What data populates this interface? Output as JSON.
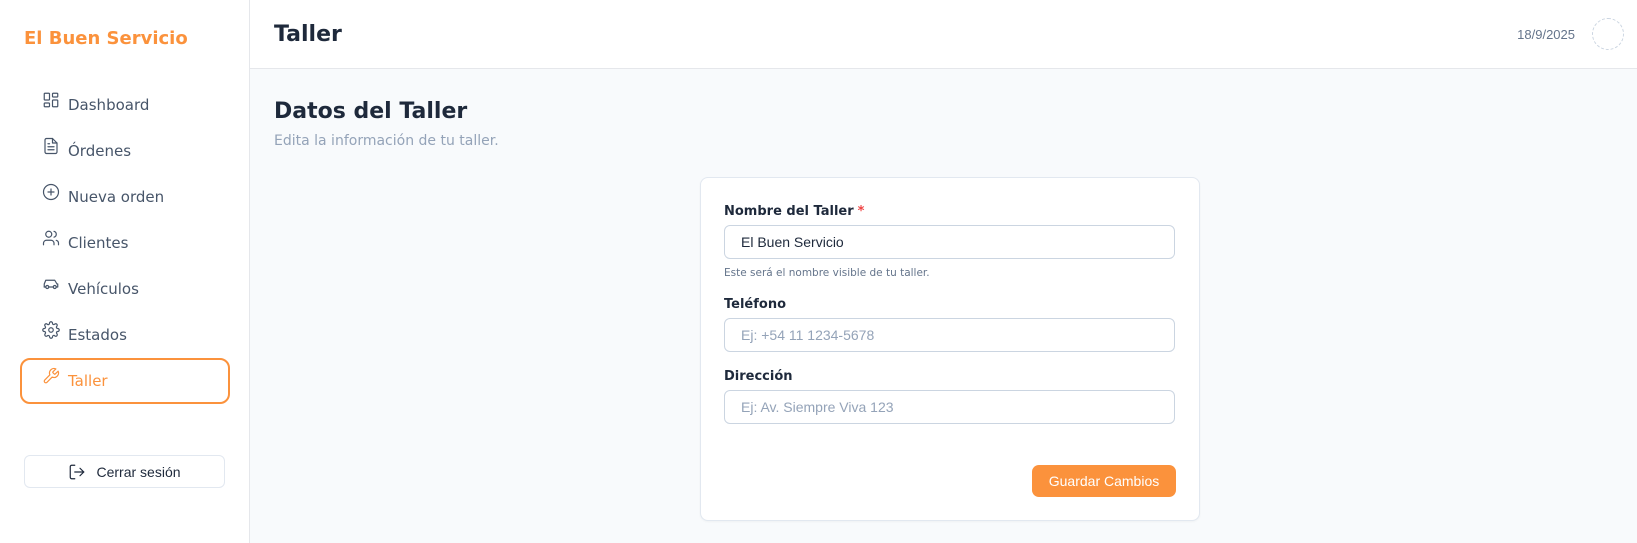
{
  "app": {
    "brand": "El Buen Servicio"
  },
  "sidebar": {
    "items": [
      {
        "label": "Dashboard",
        "icon": "dashboard-icon"
      },
      {
        "label": "Órdenes",
        "icon": "document-icon"
      },
      {
        "label": "Nueva orden",
        "icon": "plus-circle-icon"
      },
      {
        "label": "Clientes",
        "icon": "users-icon"
      },
      {
        "label": "Vehículos",
        "icon": "car-icon"
      },
      {
        "label": "Estados",
        "icon": "gear-icon"
      },
      {
        "label": "Taller",
        "icon": "wrench-icon",
        "active": true
      }
    ],
    "logout_label": "Cerrar sesión"
  },
  "header": {
    "title": "Taller",
    "date": "18/9/2025"
  },
  "main": {
    "heading": "Datos del Taller",
    "subheading": "Edita la información de tu taller."
  },
  "form": {
    "name_label": "Nombre del Taller",
    "required_mark": "*",
    "name_value": "El Buen Servicio",
    "name_hint": "Este será el nombre visible de tu taller.",
    "phone_label": "Teléfono",
    "phone_placeholder": "Ej: +54 11 1234-5678",
    "address_label": "Dirección",
    "address_placeholder": "Ej: Av. Siempre Viva 123",
    "save_label": "Guardar Cambios"
  },
  "colors": {
    "accent": "#fb923c",
    "required": "#ef4444",
    "text": "#1e293b",
    "muted": "#94a3b8"
  }
}
